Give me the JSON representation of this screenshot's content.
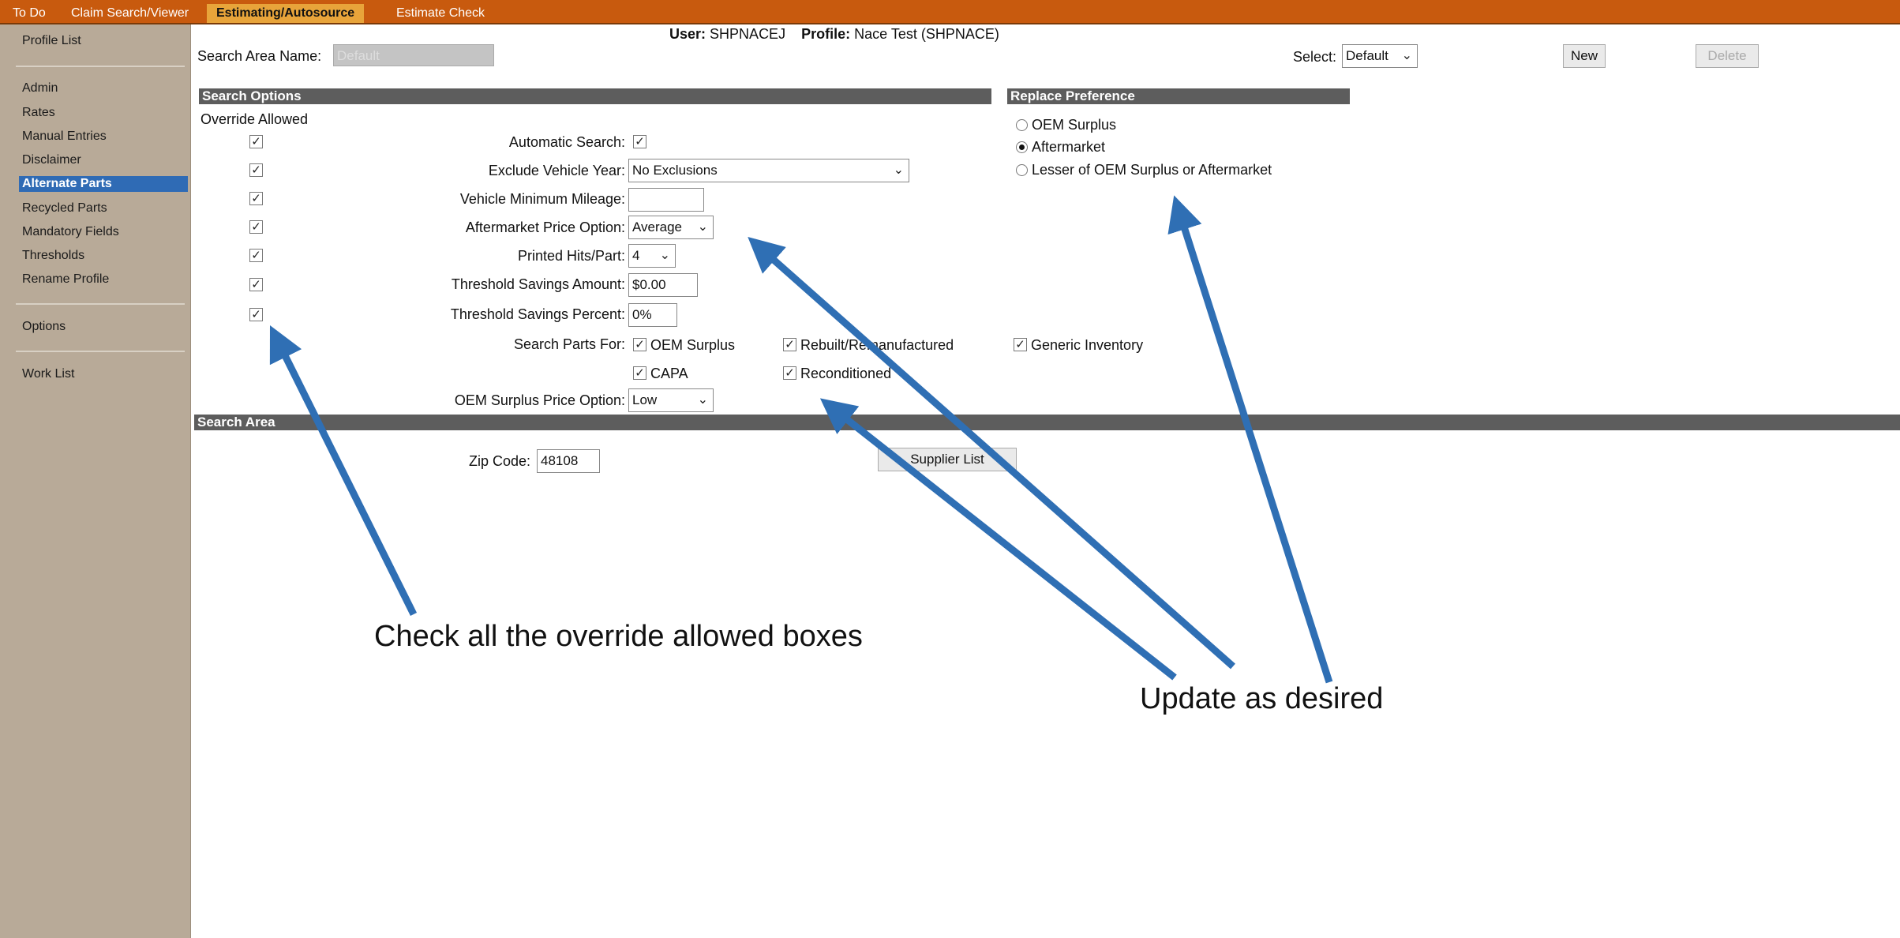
{
  "tabs": [
    "To Do",
    "Claim Search/Viewer",
    "Estimating/Autosource",
    "Estimate Check"
  ],
  "sidebar": {
    "items": [
      "Profile List",
      "Admin",
      "Rates",
      "Manual Entries",
      "Disclaimer",
      "Alternate Parts",
      "Recycled Parts",
      "Mandatory Fields",
      "Thresholds",
      "Rename Profile",
      "Options",
      "Work List"
    ]
  },
  "header": {
    "user_label": "User:",
    "user_value": "SHPNACEJ",
    "profile_label": "Profile:",
    "profile_value": "Nace Test (SHPNACE)",
    "search_area_name_label": "Search Area Name:",
    "search_area_name_value": "Default",
    "select_label": "Select:",
    "select_value": "Default",
    "new_label": "New",
    "delete_label": "Delete"
  },
  "search_options": {
    "title": "Search Options",
    "override_allowed": "Override Allowed",
    "automatic_search_label": "Automatic Search:",
    "exclude_vehicle_year_label": "Exclude Vehicle Year:",
    "exclude_vehicle_year_value": "No Exclusions",
    "vehicle_min_mileage_label": "Vehicle Minimum Mileage:",
    "vehicle_min_mileage_value": "",
    "aftermarket_price_label": "Aftermarket Price Option:",
    "aftermarket_price_value": "Average",
    "printed_hits_label": "Printed Hits/Part:",
    "printed_hits_value": "4",
    "threshold_amount_label": "Threshold Savings Amount:",
    "threshold_amount_value": "$0.00",
    "threshold_percent_label": "Threshold Savings Percent:",
    "threshold_percent_value": "0%",
    "search_parts_for_label": "Search Parts For:",
    "parts": [
      "OEM Surplus",
      "Rebuilt/Remanufactured",
      "Generic Inventory",
      "CAPA",
      "Reconditioned"
    ],
    "oem_surplus_price_label": "OEM Surplus Price Option:",
    "oem_surplus_price_value": "Low",
    "check_mark": "✓"
  },
  "replace_preference": {
    "title": "Replace Preference",
    "options": [
      "OEM Surplus",
      "Aftermarket",
      "Lesser of OEM Surplus or Aftermarket"
    ],
    "selected": "Aftermarket"
  },
  "search_area": {
    "title": "Search Area",
    "zip_label": "Zip Code:",
    "zip_value": "48108",
    "supplier_list_label": "Supplier List"
  },
  "annotations": {
    "check_all": "Check all the override allowed boxes",
    "update": "Update as desired"
  },
  "colors": {
    "topbar": "#c85a0e",
    "active_tab": "#e8a43a",
    "sidebar": "#b8aa98",
    "sidebar_active": "#2f6bb5",
    "section_header": "#5d5d5d",
    "arrow": "#2f6fb4"
  }
}
